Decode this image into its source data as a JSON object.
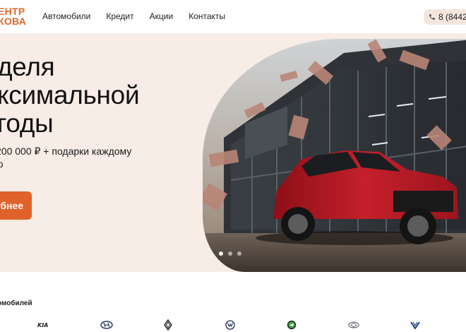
{
  "header": {
    "logo_line1": "ЕНТР",
    "logo_line2": "КОВА",
    "nav": [
      "Автомобили",
      "Кредит",
      "Акции",
      "Контакты"
    ],
    "phone": "8 (8442"
  },
  "hero": {
    "title": "деля\nксимальной\nгоды",
    "subtitle": "200 000 ₽ + подарки каждому\nю",
    "button": "бнее",
    "slides": 3,
    "active_slide": 1
  },
  "brands": {
    "title": "омобилей",
    "items": [
      "kia-logo",
      "hyundai-logo",
      "renault-logo",
      "volkswagen-logo",
      "skoda-logo",
      "chery-logo",
      "changan-logo"
    ]
  },
  "colors": {
    "accent": "#e0622a",
    "hero_bg": "#f8ece6",
    "phone_bg": "#f4e6df"
  }
}
